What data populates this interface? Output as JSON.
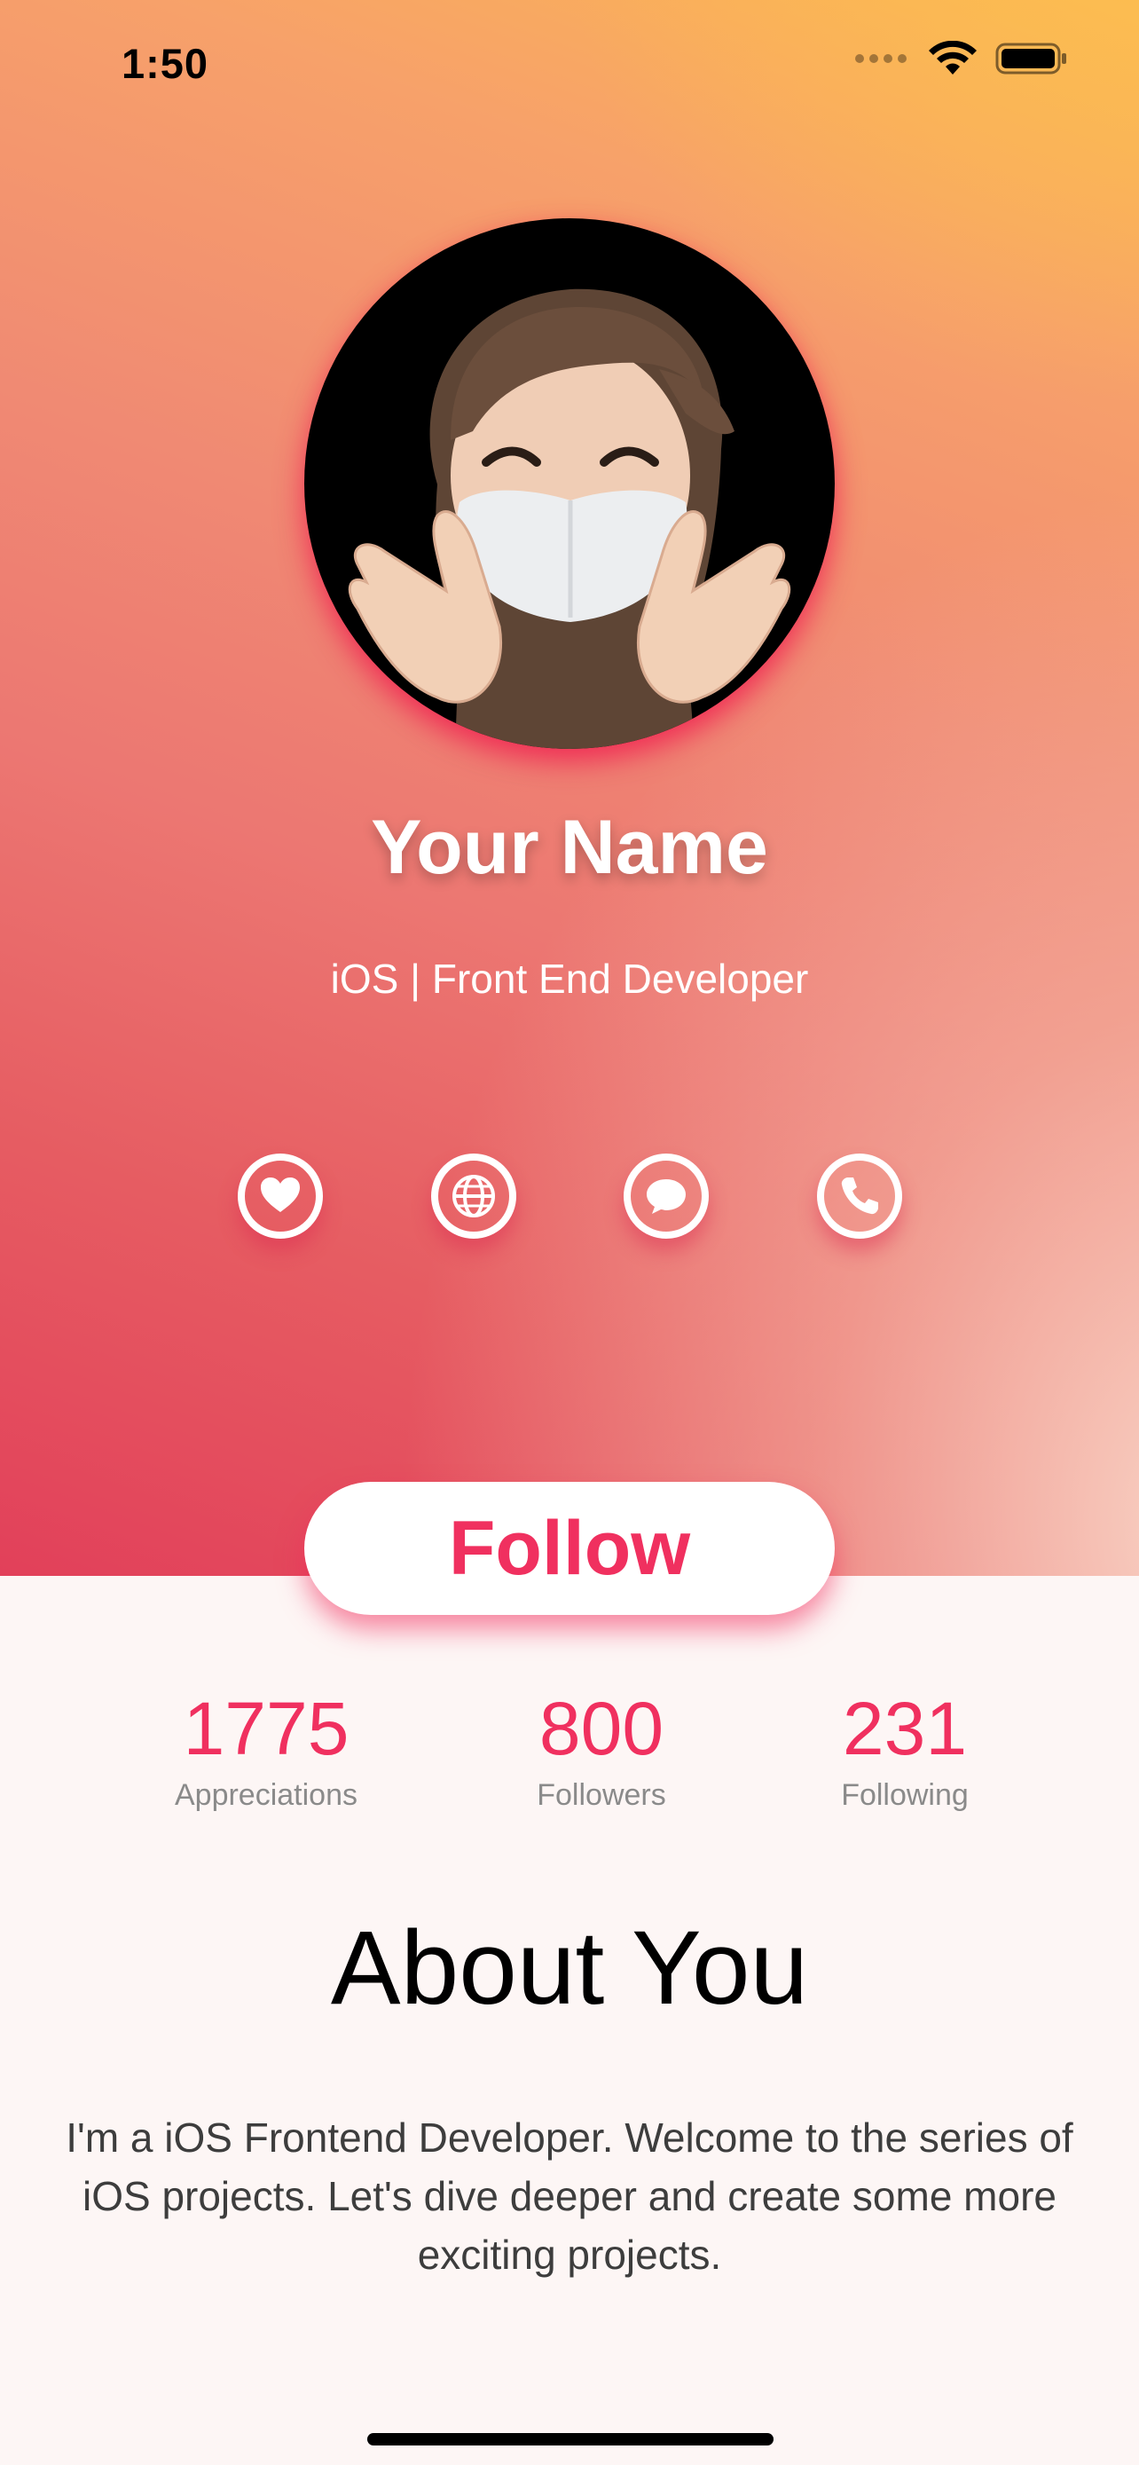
{
  "status_bar": {
    "time": "1:50",
    "icons": [
      "signal-dots-icon",
      "wifi-icon",
      "battery-icon"
    ]
  },
  "profile": {
    "avatar": "memoji-avatar-image",
    "name": "Your Name",
    "role": "iOS | Front End Developer"
  },
  "social_buttons": [
    {
      "icon": "heart-icon"
    },
    {
      "icon": "globe-icon"
    },
    {
      "icon": "message-icon"
    },
    {
      "icon": "phone-icon"
    }
  ],
  "follow_button": {
    "label": "Follow"
  },
  "stats": [
    {
      "value": "1775",
      "label": "Appreciations"
    },
    {
      "value": "800",
      "label": "Followers"
    },
    {
      "value": "231",
      "label": "Following"
    }
  ],
  "about": {
    "title": "About You",
    "text": "I'm a iOS Frontend Developer. Welcome to the series of iOS projects. Let's dive deeper and create some more exciting projects."
  },
  "colors": {
    "accent": "#f0305f",
    "gradient_top_right": "#fbb752",
    "gradient_bottom_left": "#e2405a",
    "page_background": "#fdf6f5"
  }
}
